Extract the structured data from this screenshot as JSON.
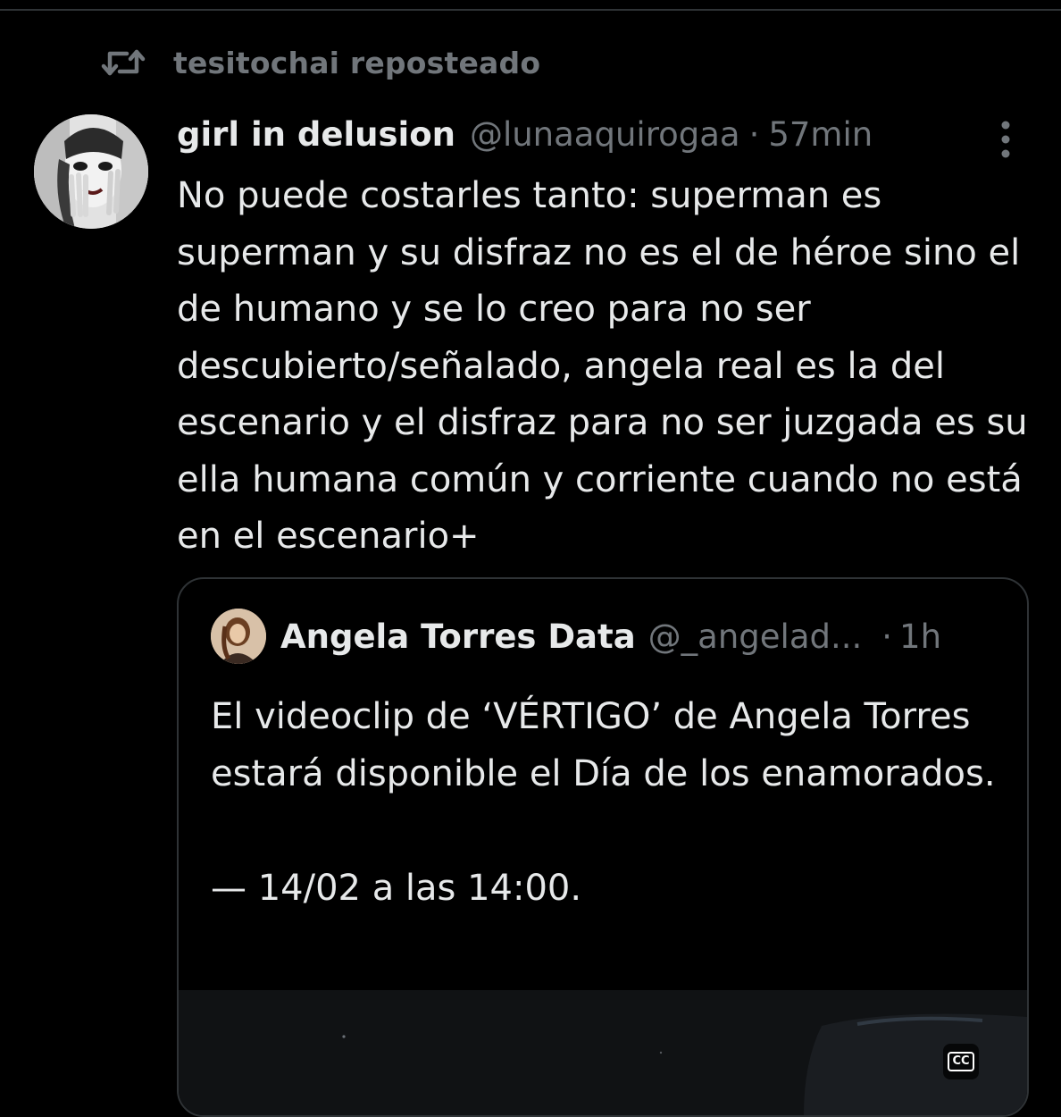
{
  "repost": {
    "icon": "repost-icon",
    "text": "tesitochai reposteado"
  },
  "tweet": {
    "avatar_icon": "avatar-image",
    "display_name": "girl in delusion",
    "handle": "@lunaaquirogaa",
    "separator": "·",
    "time": "57min",
    "more_icon": "more-vertical-icon",
    "text": "No puede costarles tanto: superman es superman y su disfraz no es el de héroe sino el de humano y se lo creo para no ser descubierto/señalado, angela real es la del escenario y el disfraz para no ser juzgada es su ella humana común y corriente cuando no está en el escenario+"
  },
  "quote": {
    "avatar_icon": "quote-avatar-image",
    "display_name": "Angela Torres Data",
    "handle": "@_angelad...",
    "separator": "·",
    "time": "1h",
    "text": "El videoclip de ‘VÉRTIGO’ de Angela Torres estará disponible el Día de los enamorados.\n\n— 14/02 a las 14:00.",
    "media": {
      "type": "video",
      "cc_label": "CC"
    }
  },
  "colors": {
    "background": "#000000",
    "primary_text": "#e7e9ea",
    "secondary_text": "#71767b",
    "border": "#2f3336"
  }
}
